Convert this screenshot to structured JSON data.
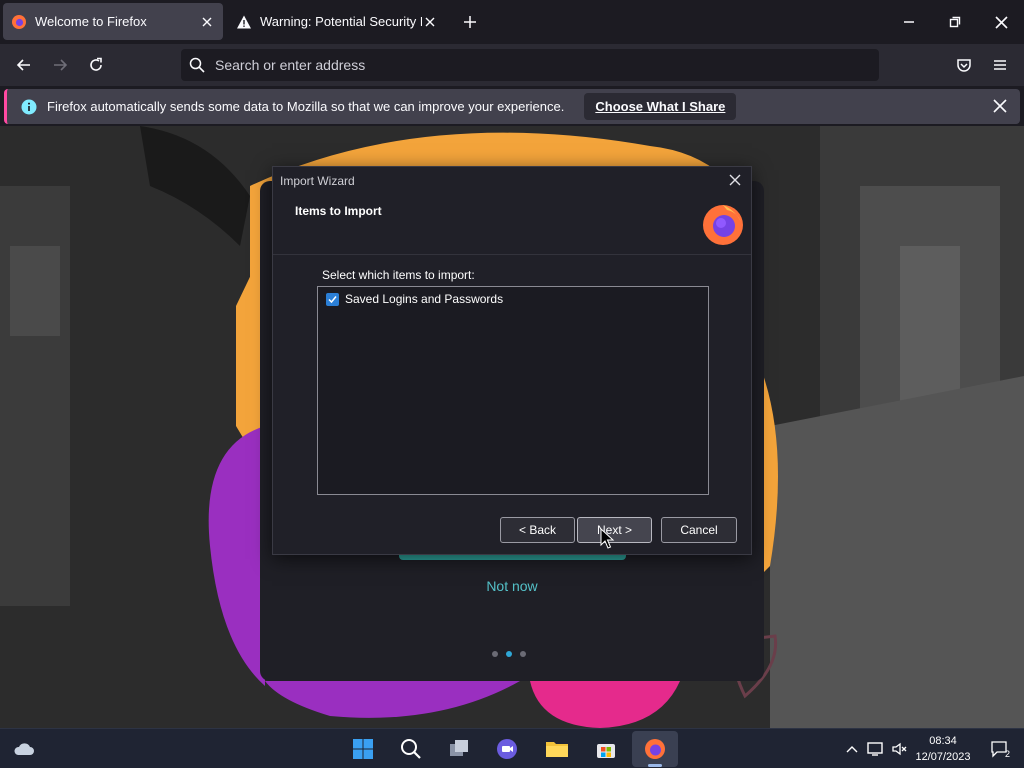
{
  "tabs": [
    {
      "title": "Welcome to Firefox",
      "favicon": "firefox-icon",
      "active": true
    },
    {
      "title": "Warning: Potential Security Risk",
      "favicon": "warning-icon",
      "active": false
    }
  ],
  "toolbar": {
    "search_placeholder": "Search or enter address"
  },
  "notification": {
    "message": "Firefox automatically sends some data to Mozilla so that we can improve your experience.",
    "button_label": "Choose What I Share"
  },
  "welcome_page": {
    "not_now_label": "Not now",
    "step_indicator": {
      "current": 2,
      "total": 3
    }
  },
  "dialog": {
    "title": "Import Wizard",
    "heading": "Items to Import",
    "prompt": "Select which items to import:",
    "items": [
      {
        "label": "Saved Logins and Passwords",
        "checked": true
      }
    ],
    "back_label": "< Back",
    "next_label": "Next >",
    "cancel_label": "Cancel"
  },
  "taskbar": {
    "time": "08:34",
    "date": "12/07/2023",
    "notification_count": "2"
  },
  "colors": {
    "accent_teal": "#54c1c8",
    "notification_bar": "#ff4aa2",
    "checkbox": "#2b7fd6"
  }
}
